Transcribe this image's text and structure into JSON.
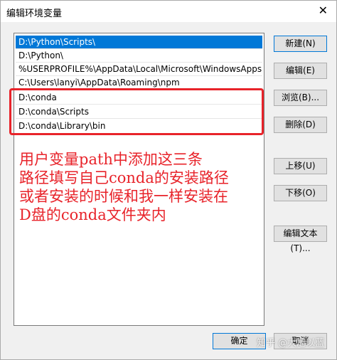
{
  "window": {
    "title": "编辑环境变量"
  },
  "paths": [
    "D:\\Python\\Scripts\\",
    "D:\\Python\\",
    "%USERPROFILE%\\AppData\\Local\\Microsoft\\WindowsApps",
    "C:\\Users\\lanyi\\AppData\\Roaming\\npm",
    "D:\\conda",
    "D:\\conda\\Scripts",
    "D:\\conda\\Library\\bin"
  ],
  "selected_index": 0,
  "annotation": {
    "lines": [
      "用户变量path中添加这三条",
      "路径填写自己conda的安装路径",
      "或者安装的时候和我一样安装在",
      "D盘的conda文件夹内"
    ]
  },
  "buttons": {
    "new": "新建(N)",
    "edit": "编辑(E)",
    "browse": "浏览(B)...",
    "delete": "删除(D)",
    "move_up": "上移(U)",
    "move_down": "下移(O)",
    "edit_text": "编辑文本(T)...",
    "ok": "确定",
    "cancel": "取消"
  },
  "watermark": "知乎 @大旭以蓝",
  "colors": {
    "selection": "#0078d7",
    "annotation": "#e8232a"
  }
}
